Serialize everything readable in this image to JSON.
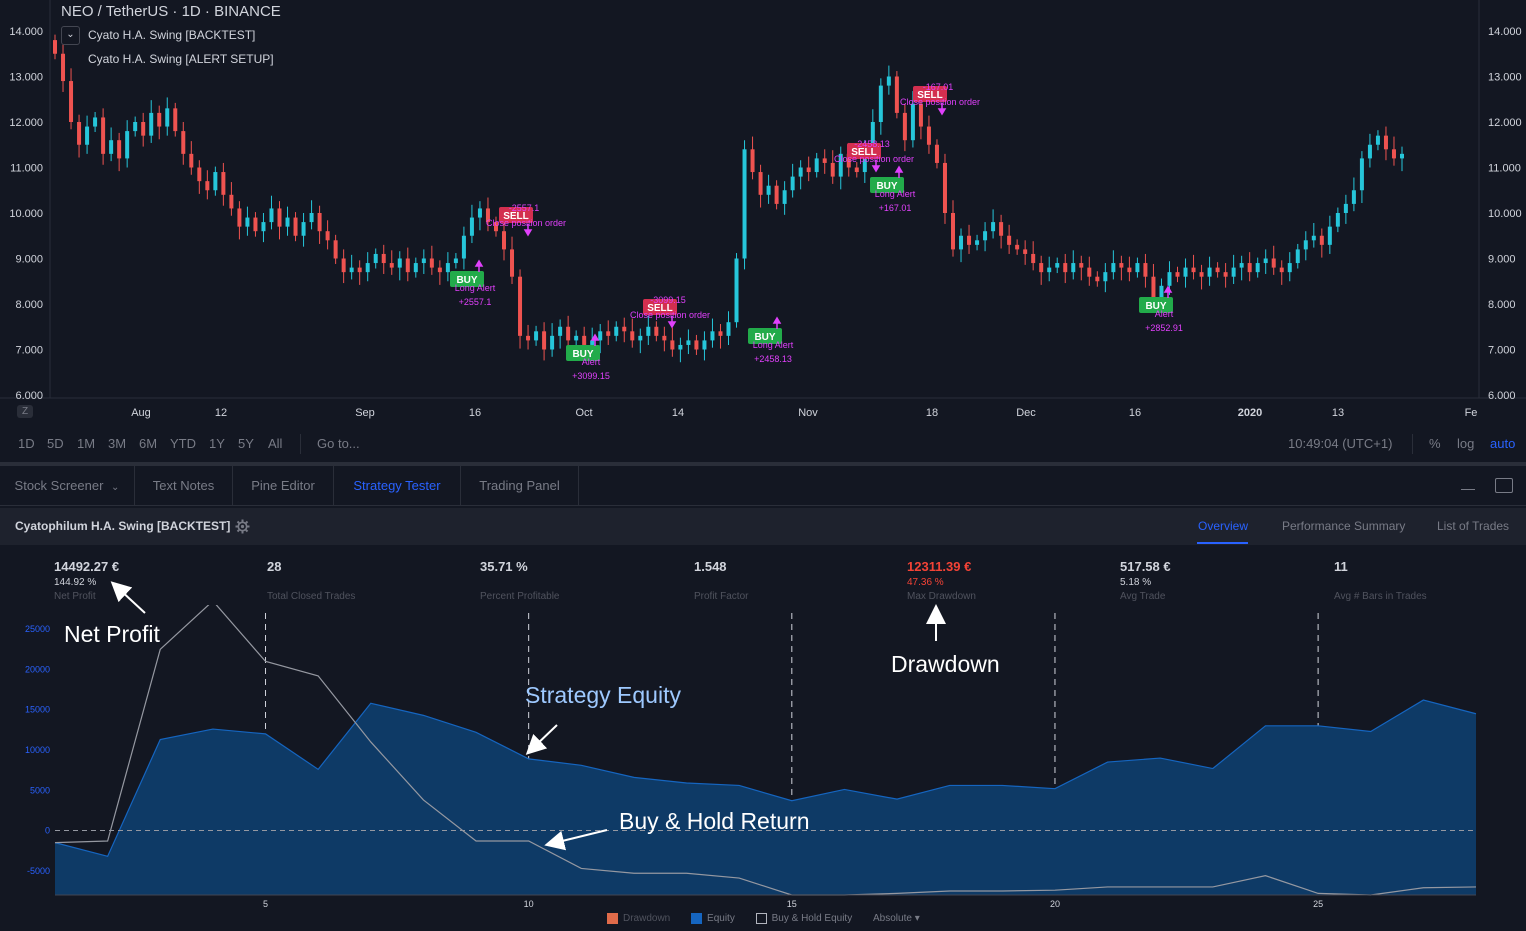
{
  "colors": {
    "background": "#131722",
    "up": "#26c6da",
    "down": "#ef5350",
    "buy": "#22ab4a",
    "sell": "#d32f4f",
    "alert": "#e040fb",
    "accent": "#2962ff",
    "drawdown": "#f44336",
    "equity_fill": "#0e3a66",
    "equity_line": "#1565c0"
  },
  "chart": {
    "title": "NEO / TetherUS · 1D · BINANCE",
    "indicators": [
      {
        "label": "Cyato H.A. Swing [BACKTEST]"
      },
      {
        "label": "Cyato H.A. Swing [ALERT SETUP]"
      }
    ],
    "collapse_icon": "chevron-down-icon",
    "zoom_label": "Z",
    "y_ticks": [
      "14.000",
      "13.000",
      "12.000",
      "11.000",
      "10.000",
      "9.000",
      "8.000",
      "7.000",
      "6.000"
    ],
    "x_ticks": [
      "Aug",
      "12",
      "Sep",
      "16",
      "Oct",
      "14",
      "Nov",
      "18",
      "Dec",
      "16",
      "2020",
      "13",
      "Fe"
    ],
    "candles_close": [
      13.5,
      12.9,
      12.0,
      11.5,
      11.9,
      12.1,
      11.3,
      11.6,
      11.2,
      11.8,
      12.0,
      11.7,
      12.2,
      11.9,
      12.3,
      11.8,
      11.3,
      11.0,
      10.7,
      10.5,
      10.9,
      10.4,
      10.1,
      9.7,
      9.9,
      9.6,
      9.8,
      10.1,
      9.7,
      9.9,
      9.5,
      9.8,
      10.0,
      9.6,
      9.4,
      9.0,
      8.7,
      8.8,
      8.7,
      8.9,
      9.1,
      8.9,
      8.8,
      9.0,
      8.7,
      8.9,
      9.0,
      8.8,
      8.7,
      8.9,
      9.0,
      9.5,
      9.9,
      10.1,
      9.8,
      9.6,
      9.2,
      8.6,
      7.3,
      7.2,
      7.4,
      7.0,
      7.3,
      7.5,
      7.2,
      7.3,
      7.1,
      7.2,
      7.4,
      7.3,
      7.5,
      7.4,
      7.2,
      7.3,
      7.5,
      7.3,
      7.2,
      7.0,
      7.1,
      7.2,
      7.0,
      7.2,
      7.4,
      7.3,
      7.6,
      9.0,
      11.4,
      10.9,
      10.4,
      10.6,
      10.2,
      10.5,
      10.8,
      11.0,
      10.9,
      11.2,
      11.1,
      10.8,
      11.3,
      11.0,
      10.9,
      11.4,
      12.0,
      12.8,
      13.0,
      12.2,
      11.6,
      12.4,
      11.9,
      11.5,
      11.1,
      10.0,
      9.2,
      9.5,
      9.3,
      9.4,
      9.6,
      9.8,
      9.5,
      9.3,
      9.2,
      9.1,
      8.9,
      8.7,
      8.8,
      8.9,
      8.7,
      8.9,
      8.8,
      8.6,
      8.5,
      8.7,
      8.9,
      8.8,
      8.7,
      8.9,
      8.6,
      8.1,
      8.4,
      8.7,
      8.6,
      8.8,
      8.7,
      8.6,
      8.8,
      8.7,
      8.6,
      8.8,
      8.9,
      8.7,
      8.9,
      9.0,
      8.8,
      8.7,
      8.9,
      9.2,
      9.4,
      9.5,
      9.3,
      9.7,
      10.0,
      10.2,
      10.5,
      11.2,
      11.5,
      11.7,
      11.4,
      11.2,
      11.3
    ],
    "signals": [
      {
        "type": "BUY",
        "label": "BUY",
        "note": "Long Alert",
        "value": "+2557.1"
      },
      {
        "type": "SELL",
        "label": "SELL",
        "note": "Close position order",
        "value": "-2557.1"
      },
      {
        "type": "BUY",
        "label": "BUY",
        "note": "Alert",
        "value": "+3099.15"
      },
      {
        "type": "SELL",
        "label": "SELL",
        "note": "Close position order",
        "value": "-3099.15"
      },
      {
        "type": "BUY",
        "label": "BUY",
        "note": "Long Alert",
        "value": "+2458.13"
      },
      {
        "type": "SELL",
        "label": "SELL",
        "note": "Close position order",
        "value": "-2458.13"
      },
      {
        "type": "BUY",
        "label": "BUY",
        "note": "Long Alert",
        "value": "+167.01"
      },
      {
        "type": "SELL",
        "label": "SELL",
        "note": "Close position order",
        "value": "-167.01"
      },
      {
        "type": "BUY",
        "label": "BUY",
        "note": "Alert",
        "value": "+2852.91"
      }
    ]
  },
  "range_bar": {
    "periods": [
      "1D",
      "5D",
      "1M",
      "3M",
      "6M",
      "YTD",
      "1Y",
      "5Y",
      "All"
    ],
    "goto": "Go to...",
    "time": "10:49:04 (UTC+1)",
    "percent": "%",
    "log": "log",
    "auto": "auto"
  },
  "bottom_tabs": {
    "tabs": [
      "Stock Screener",
      "Text Notes",
      "Pine Editor",
      "Strategy Tester",
      "Trading Panel"
    ],
    "active": "Strategy Tester",
    "minimize_icon": "minimize-icon",
    "maximize_icon": "maximize-icon"
  },
  "strategy": {
    "title": "Cyatophilum H.A. Swing [BACKTEST]",
    "settings_icon": "gear-icon",
    "tabs": [
      "Overview",
      "Performance Summary",
      "List of Trades"
    ],
    "active_tab": "Overview",
    "stats": [
      {
        "value": "14492.27 €",
        "sub": "144.92 %",
        "label": "Net Profit"
      },
      {
        "value": "28",
        "sub": "",
        "label": "Total Closed Trades"
      },
      {
        "value": "35.71 %",
        "sub": "",
        "label": "Percent Profitable"
      },
      {
        "value": "1.548",
        "sub": "",
        "label": "Profit Factor"
      },
      {
        "value": "12311.39 €",
        "sub": "47.36 %",
        "label": "Max Drawdown"
      },
      {
        "value": "517.58 €",
        "sub": "5.18 %",
        "label": "Avg Trade"
      },
      {
        "value": "11",
        "sub": "",
        "label": "Avg # Bars in Trades"
      }
    ]
  },
  "chart_data": {
    "type": "area",
    "x": [
      1,
      2,
      3,
      4,
      5,
      6,
      7,
      8,
      9,
      10,
      11,
      12,
      13,
      14,
      15,
      16,
      17,
      18,
      19,
      20,
      21,
      22,
      23,
      24,
      25,
      26,
      27,
      28
    ],
    "x_ticks": [
      "5",
      "10",
      "15",
      "20",
      "25"
    ],
    "y_ticks": [
      "25000",
      "20000",
      "15000",
      "10000",
      "5000",
      "0",
      "-5000"
    ],
    "ylim": [
      -8000,
      28000
    ],
    "series": [
      {
        "name": "Equity",
        "values": [
          -1500,
          -3200,
          11300,
          12600,
          12000,
          7600,
          15800,
          14300,
          12200,
          8900,
          8100,
          6600,
          5900,
          5600,
          3700,
          5100,
          3900,
          5600,
          5600,
          5200,
          8500,
          9000,
          7700,
          13000,
          13000,
          12300,
          16200,
          14500
        ]
      },
      {
        "name": "Buy & Hold Equity",
        "values": [
          -1500,
          -1300,
          22500,
          28500,
          21000,
          19200,
          11000,
          3800,
          -1300,
          -1300,
          -4700,
          -5300,
          -5300,
          -5900,
          -8000,
          -8000,
          -7800,
          -7500,
          -7500,
          -7400,
          -7000,
          -7000,
          -7000,
          -5600,
          -7800,
          -8000,
          -7100,
          -7000
        ]
      }
    ],
    "legend": [
      "Drawdown",
      "Equity",
      "Buy & Hold Equity",
      "Absolute"
    ]
  },
  "annotations": {
    "net_profit": "Net Profit",
    "drawdown": "Drawdown",
    "strategy_equity": "Strategy Equity",
    "buy_hold": "Buy & Hold Return"
  }
}
